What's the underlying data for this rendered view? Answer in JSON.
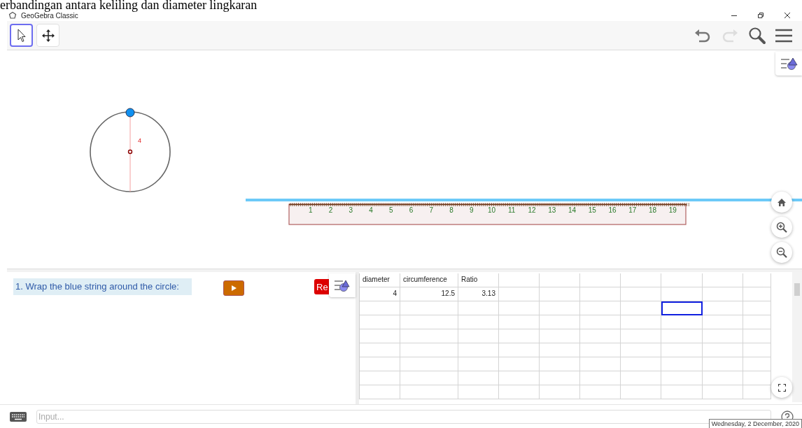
{
  "page_heading": "erbandingan antara keliling dan diameter lingkaran",
  "window": {
    "title": "GeoGebra Classic"
  },
  "toolbar": {
    "tools": [
      {
        "kind": "pointer",
        "selected": true
      },
      {
        "kind": "move",
        "selected": false
      }
    ]
  },
  "graphics": {
    "segment_label": "4",
    "ruler_labels": [
      "1",
      "2",
      "3",
      "4",
      "5",
      "6",
      "7",
      "8",
      "9",
      "10",
      "11",
      "12",
      "13",
      "14",
      "15",
      "16",
      "17",
      "18",
      "19"
    ]
  },
  "panel": {
    "instruction": "1. Wrap the blue string around the circle:",
    "reset_label": "Re"
  },
  "spreadsheet": {
    "rows": [
      [
        {
          "text": "diameter",
          "kind": "text",
          "selected": false
        },
        {
          "text": "circumference",
          "kind": "text",
          "selected": false
        },
        {
          "text": "Ratio",
          "kind": "text",
          "selected": false
        },
        {
          "selected": false
        },
        {
          "selected": false
        },
        {
          "selected": false
        },
        {
          "selected": false
        },
        {
          "selected": false
        },
        {
          "selected": false
        },
        {
          "selected": false
        }
      ],
      [
        {
          "text": "4",
          "kind": "number",
          "selected": false
        },
        {
          "text": "12.5",
          "kind": "number",
          "selected": false
        },
        {
          "text": "3.13",
          "kind": "number",
          "selected": false
        },
        {
          "selected": false
        },
        {
          "selected": false
        },
        {
          "selected": false
        },
        {
          "selected": false
        },
        {
          "selected": false
        },
        {
          "selected": false
        },
        {
          "selected": false
        }
      ],
      [
        {
          "selected": false
        },
        {
          "selected": false
        },
        {
          "selected": false
        },
        {
          "selected": false
        },
        {
          "selected": false
        },
        {
          "selected": false
        },
        {
          "selected": false
        },
        {
          "selected": true
        },
        {
          "selected": false
        },
        {
          "selected": false
        }
      ],
      [
        {
          "selected": false
        },
        {
          "selected": false
        },
        {
          "selected": false
        },
        {
          "selected": false
        },
        {
          "selected": false
        },
        {
          "selected": false
        },
        {
          "selected": false
        },
        {
          "selected": false
        },
        {
          "selected": false
        },
        {
          "selected": false
        }
      ],
      [
        {
          "selected": false
        },
        {
          "selected": false
        },
        {
          "selected": false
        },
        {
          "selected": false
        },
        {
          "selected": false
        },
        {
          "selected": false
        },
        {
          "selected": false
        },
        {
          "selected": false
        },
        {
          "selected": false
        },
        {
          "selected": false
        }
      ],
      [
        {
          "selected": false
        },
        {
          "selected": false
        },
        {
          "selected": false
        },
        {
          "selected": false
        },
        {
          "selected": false
        },
        {
          "selected": false
        },
        {
          "selected": false
        },
        {
          "selected": false
        },
        {
          "selected": false
        },
        {
          "selected": false
        }
      ],
      [
        {
          "selected": false
        },
        {
          "selected": false
        },
        {
          "selected": false
        },
        {
          "selected": false
        },
        {
          "selected": false
        },
        {
          "selected": false
        },
        {
          "selected": false
        },
        {
          "selected": false
        },
        {
          "selected": false
        },
        {
          "selected": false
        }
      ],
      [
        {
          "selected": false
        },
        {
          "selected": false
        },
        {
          "selected": false
        },
        {
          "selected": false
        },
        {
          "selected": false
        },
        {
          "selected": false
        },
        {
          "selected": false
        },
        {
          "selected": false
        },
        {
          "selected": false
        },
        {
          "selected": false
        }
      ],
      [
        {
          "selected": false
        },
        {
          "selected": false
        },
        {
          "selected": false
        },
        {
          "selected": false
        },
        {
          "selected": false
        },
        {
          "selected": false
        },
        {
          "selected": false
        },
        {
          "selected": false
        },
        {
          "selected": false
        },
        {
          "selected": false
        }
      ]
    ]
  },
  "input_bar": {
    "placeholder": "Input..."
  },
  "tooltip": "Wednesday, 2 December, 2020"
}
